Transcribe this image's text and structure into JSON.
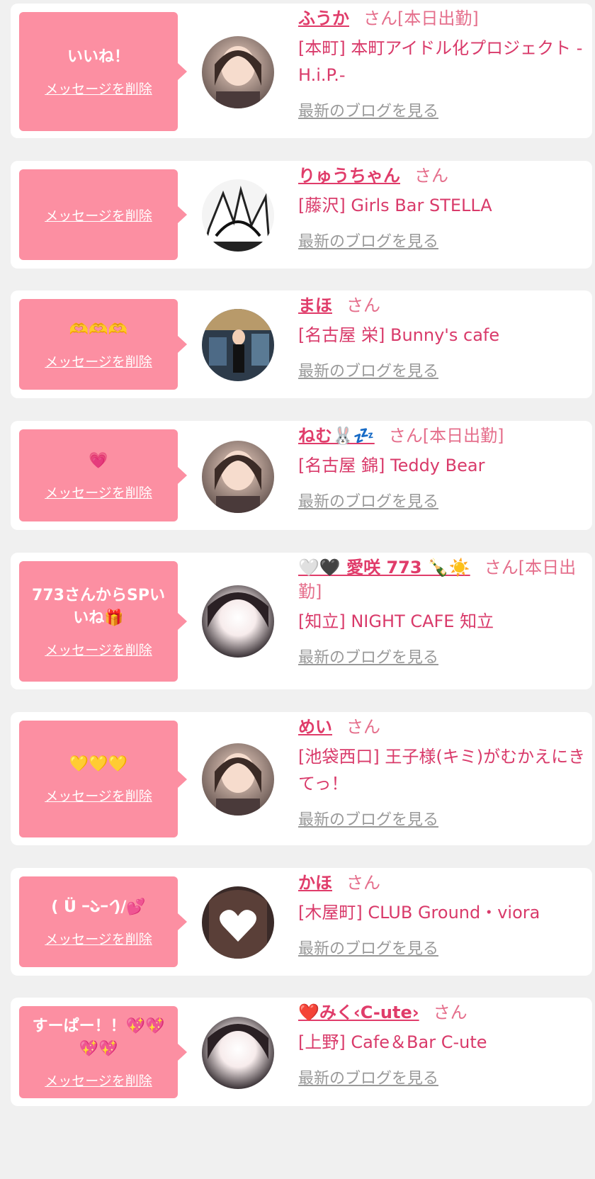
{
  "delete_label": "メッセージを削除",
  "blog_label": "最新のブログを見る",
  "san_label": "さん",
  "colors": {
    "background": "#f0f0f0",
    "bubble": "#fc8fa2",
    "name": "#e03c6a",
    "link_gray": "#999999"
  },
  "messages": [
    {
      "message": "いいね！",
      "name": "ふうか",
      "tag": "[本日出勤]",
      "shop": "[本町] 本町アイドル化プロジェクト -H.i.P.-",
      "avatar_icon": "girl-photo-avatar"
    },
    {
      "message": "",
      "name": "りゅうちゃん",
      "tag": "",
      "shop": "[藤沢] Girls Bar STELLA",
      "avatar_icon": "manga-avatar"
    },
    {
      "message": "🫶🫶🫶",
      "name": "まほ",
      "tag": "",
      "shop": "[名古屋 栄] Bunny's cafe",
      "avatar_icon": "bunny-girl-avatar"
    },
    {
      "message": "💗",
      "name": "ねむ🐰💤",
      "tag": "[本日出勤]",
      "shop": "[名古屋 錦] Teddy Bear",
      "avatar_icon": "girl-photo-avatar"
    },
    {
      "message": "773さんからSPいいね🎁",
      "name": "🤍🖤 愛咲 773 🍾☀️",
      "tag": "[本日出勤]",
      "shop": "[知立] NIGHT CAFE 知立",
      "avatar_icon": "blurred-face-avatar"
    },
    {
      "message": "💛💛💛",
      "name": "めい",
      "tag": "",
      "shop": "[池袋西口] 王子様(キミ)がむかえにきてっ！",
      "avatar_icon": "girl-photo-avatar"
    },
    {
      "message": "( Ü ｰ̀ᴗｰ́ )/💕",
      "name": "かほ",
      "tag": "",
      "shop": "[木屋町] CLUB Ground・viora",
      "avatar_icon": "heart-sticker-avatar"
    },
    {
      "message": "すーぱー！！💖💖💖💖",
      "name": "❤️みく‹C-ute›",
      "tag": "",
      "shop": "[上野] Cafe＆Bar C-ute",
      "avatar_icon": "blurred-face-avatar"
    }
  ]
}
